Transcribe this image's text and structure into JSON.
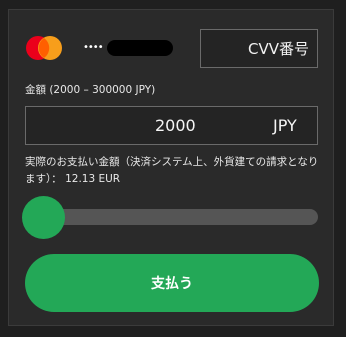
{
  "card": {
    "brand_icon": "mastercard-icon",
    "masked_number": "••••"
  },
  "cvv": {
    "placeholder": "CVV番号"
  },
  "amount": {
    "label": "金額 (2000 – 300000 JPY)",
    "value": "2000",
    "currency": "JPY"
  },
  "summary": {
    "text": "実際のお支払い金額（決済システム上、外貨建ての請求となります）： 12.13 EUR"
  },
  "slider": {
    "level": 0
  },
  "pay_button": {
    "label": "支払う"
  },
  "colors": {
    "accent": "#23a857",
    "background": "#2a2a2a",
    "border": "#6a6a6a",
    "track": "#555555"
  }
}
